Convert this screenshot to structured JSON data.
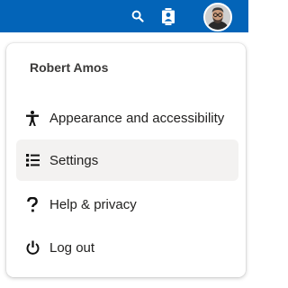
{
  "header": {
    "background_color": "#0364b8",
    "search_icon": "search-icon",
    "contacts_icon": "contact-card-icon",
    "avatar_icon": "user-avatar"
  },
  "menu": {
    "user_name": "Robert Amos",
    "items": [
      {
        "label": "Appearance and accessibility",
        "icon": "accessibility-icon"
      },
      {
        "label": "Settings",
        "icon": "settings-list-icon",
        "highlighted": true
      },
      {
        "label": "Help & privacy",
        "icon": "question-mark-icon"
      },
      {
        "label": "Log out",
        "icon": "power-icon"
      }
    ]
  }
}
